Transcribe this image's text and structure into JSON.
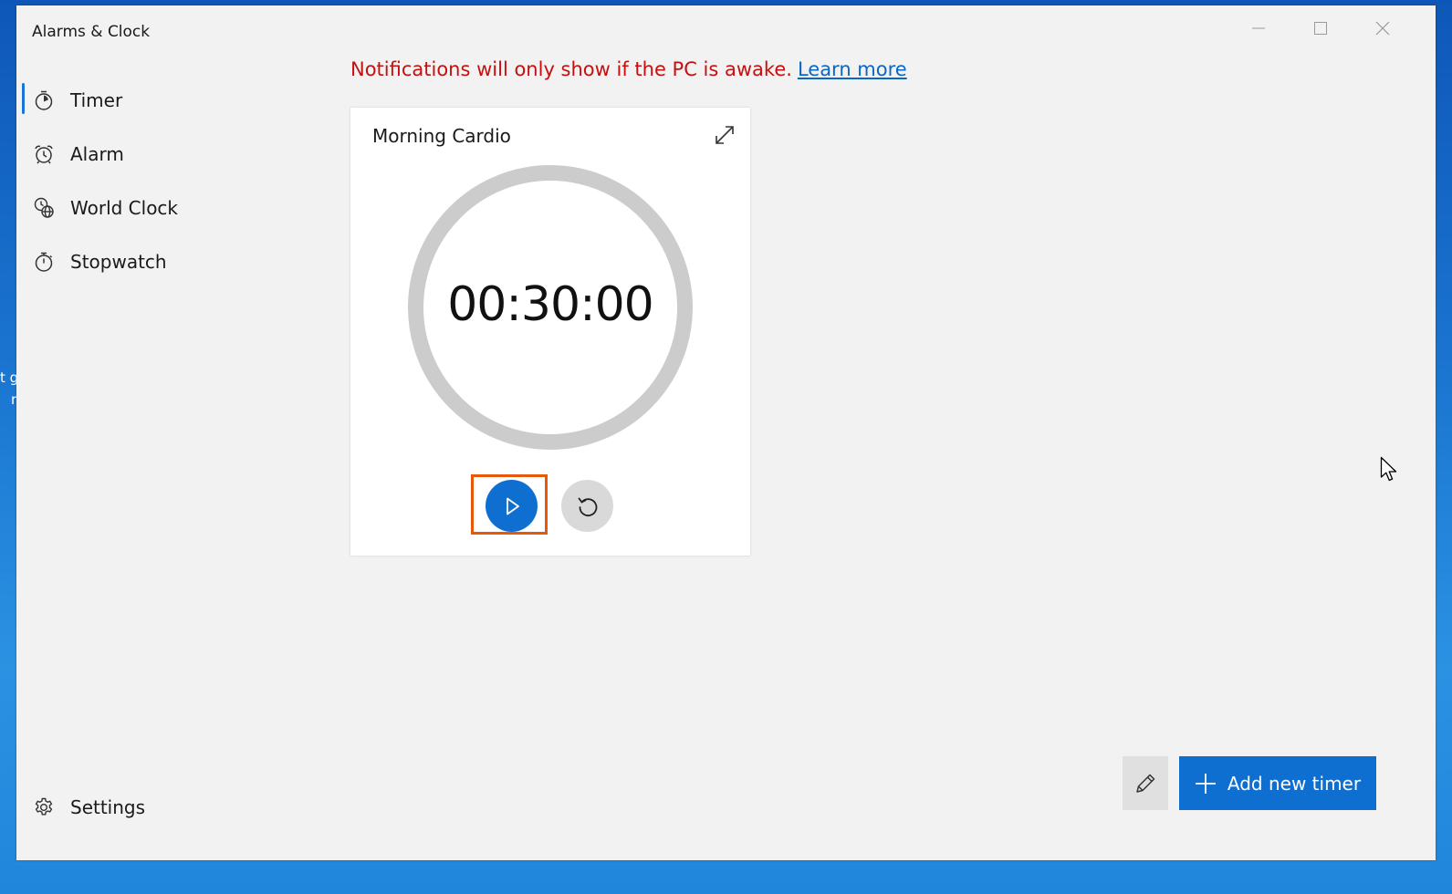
{
  "desktop": {
    "fragment_line1": "t g",
    "fragment_line2": "r"
  },
  "window": {
    "title": "Alarms & Clock",
    "controls": [
      "minimize-icon",
      "maximize-icon",
      "close-icon"
    ]
  },
  "nav": {
    "items": [
      {
        "label": "Timer",
        "icon": "timer-icon",
        "selected": true
      },
      {
        "label": "Alarm",
        "icon": "alarm-icon",
        "selected": false
      },
      {
        "label": "World Clock",
        "icon": "world-clock-icon",
        "selected": false
      },
      {
        "label": "Stopwatch",
        "icon": "stopwatch-icon",
        "selected": false
      }
    ],
    "settings_label": "Settings"
  },
  "notification": {
    "message": "Notifications will only show if the PC is awake.",
    "link_label": "Learn more"
  },
  "timer": {
    "name": "Morning Cardio",
    "time": "00:30:00",
    "state": "stopped",
    "highlighted_control": "play-button"
  },
  "actions": {
    "add_label": "Add new timer"
  },
  "colors": {
    "accent": "#0f6fd1",
    "warning_text": "#c80f0f",
    "link": "#0a67c8",
    "highlight_box": "#e8580c",
    "ring": "#cccccc"
  }
}
